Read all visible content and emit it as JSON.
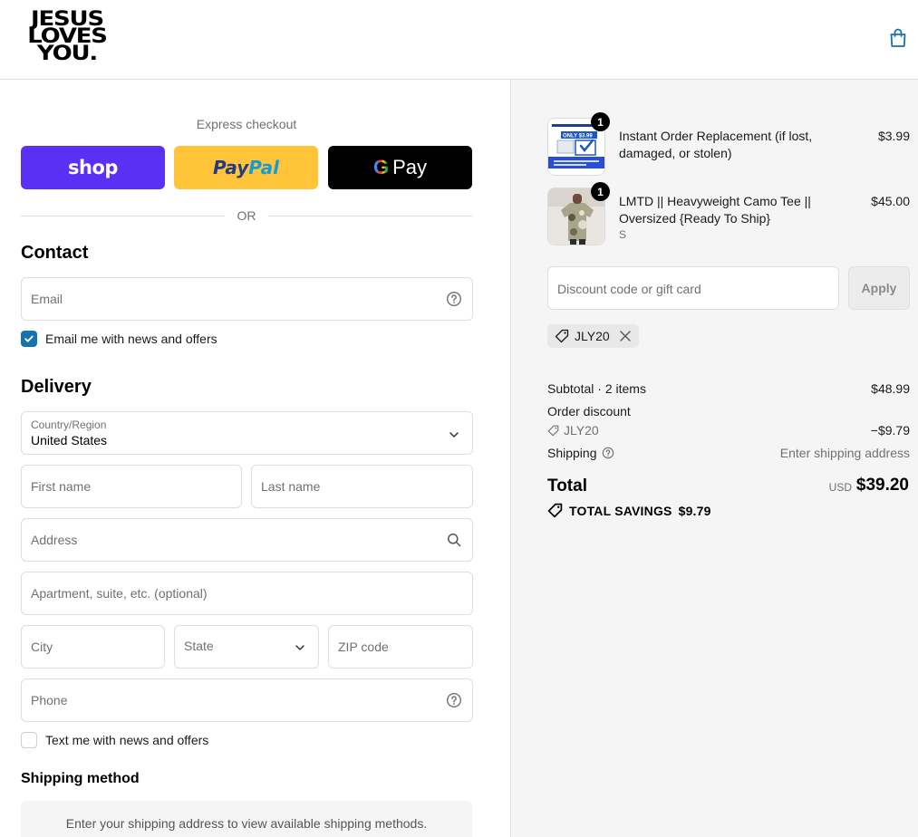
{
  "header": {
    "logo_lines": [
      "JESUS",
      "LOVES",
      "YOU."
    ],
    "cart_icon": "bag-icon"
  },
  "express": {
    "label": "Express checkout",
    "shop_label": "shop",
    "paypal_part1": "Pay",
    "paypal_part2": "Pal",
    "gpay_g": "G",
    "gpay_label": "Pay",
    "or_label": "OR"
  },
  "contact": {
    "title": "Contact",
    "email_placeholder": "Email",
    "news_label": "Email me with news and offers",
    "news_checked": true
  },
  "delivery": {
    "title": "Delivery",
    "country_label": "Country/Region",
    "country_value": "United States",
    "first_name_placeholder": "First name",
    "last_name_placeholder": "Last name",
    "address_placeholder": "Address",
    "apartment_placeholder": "Apartment, suite, etc. (optional)",
    "city_placeholder": "City",
    "state_placeholder": "State",
    "zip_placeholder": "ZIP code",
    "phone_placeholder": "Phone",
    "text_label": "Text me with news and offers",
    "text_checked": false
  },
  "shipping_method": {
    "title": "Shipping method",
    "notice": "Enter your shipping address to view available shipping methods."
  },
  "order": {
    "items": [
      {
        "name": "Instant Order Replacement (if lost, damaged, or stolen)",
        "variant": "",
        "price": "$3.99",
        "qty": "1",
        "thumb_text": "ONLY $3.99"
      },
      {
        "name": "LMTD || Heavyweight Camo Tee || Oversized {Ready To Ship}",
        "variant": "S",
        "price": "$45.00",
        "qty": "1"
      }
    ],
    "discount_placeholder": "Discount code or gift card",
    "apply_label": "Apply",
    "applied_code": "JLY20",
    "subtotal_label": "Subtotal · 2 items",
    "subtotal_value": "$48.99",
    "order_discount_label": "Order discount",
    "discount_code": "JLY20",
    "discount_value": "−$9.79",
    "shipping_label": "Shipping",
    "shipping_value": "Enter shipping address",
    "total_label": "Total",
    "total_currency": "USD",
    "total_value": "$39.20",
    "savings_label": "TOTAL SAVINGS",
    "savings_value": "$9.79"
  },
  "colors": {
    "shop_purple": "#5a31f4",
    "paypal_yellow": "#ffc439",
    "checkbox_blue": "#1773b0"
  }
}
